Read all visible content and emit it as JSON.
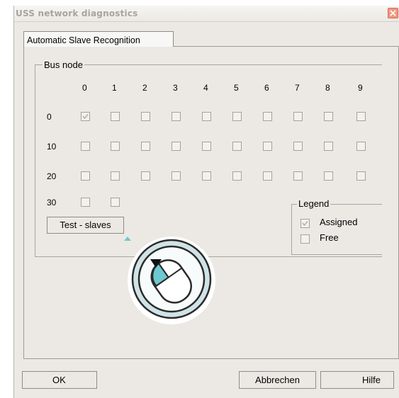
{
  "window": {
    "title": "USS network diagnostics"
  },
  "tab": {
    "label": "Automatic Slave Recognition"
  },
  "bus_node": {
    "label": "Bus node",
    "columns": [
      "0",
      "1",
      "2",
      "3",
      "4",
      "5",
      "6",
      "7",
      "8",
      "9"
    ],
    "rows": [
      {
        "label": "0",
        "checked": [
          true,
          false,
          false,
          false,
          false,
          false,
          false,
          false,
          false,
          false
        ]
      },
      {
        "label": "10",
        "checked": [
          false,
          false,
          false,
          false,
          false,
          false,
          false,
          false,
          false,
          false
        ]
      },
      {
        "label": "20",
        "checked": [
          false,
          false,
          false,
          false,
          false,
          false,
          false,
          false,
          false,
          false
        ]
      },
      {
        "label": "30",
        "checked": [
          false,
          false
        ]
      }
    ]
  },
  "test_button": {
    "label": "Test - slaves"
  },
  "legend": {
    "title": "Legend",
    "assigned": "Assigned",
    "free": "Free"
  },
  "buttons": {
    "ok": "OK",
    "cancel": "Abbrechen",
    "help": "Hilfe"
  },
  "colors": {
    "accent_teal": "#6ec8cf",
    "close_button": "#ee9980"
  }
}
